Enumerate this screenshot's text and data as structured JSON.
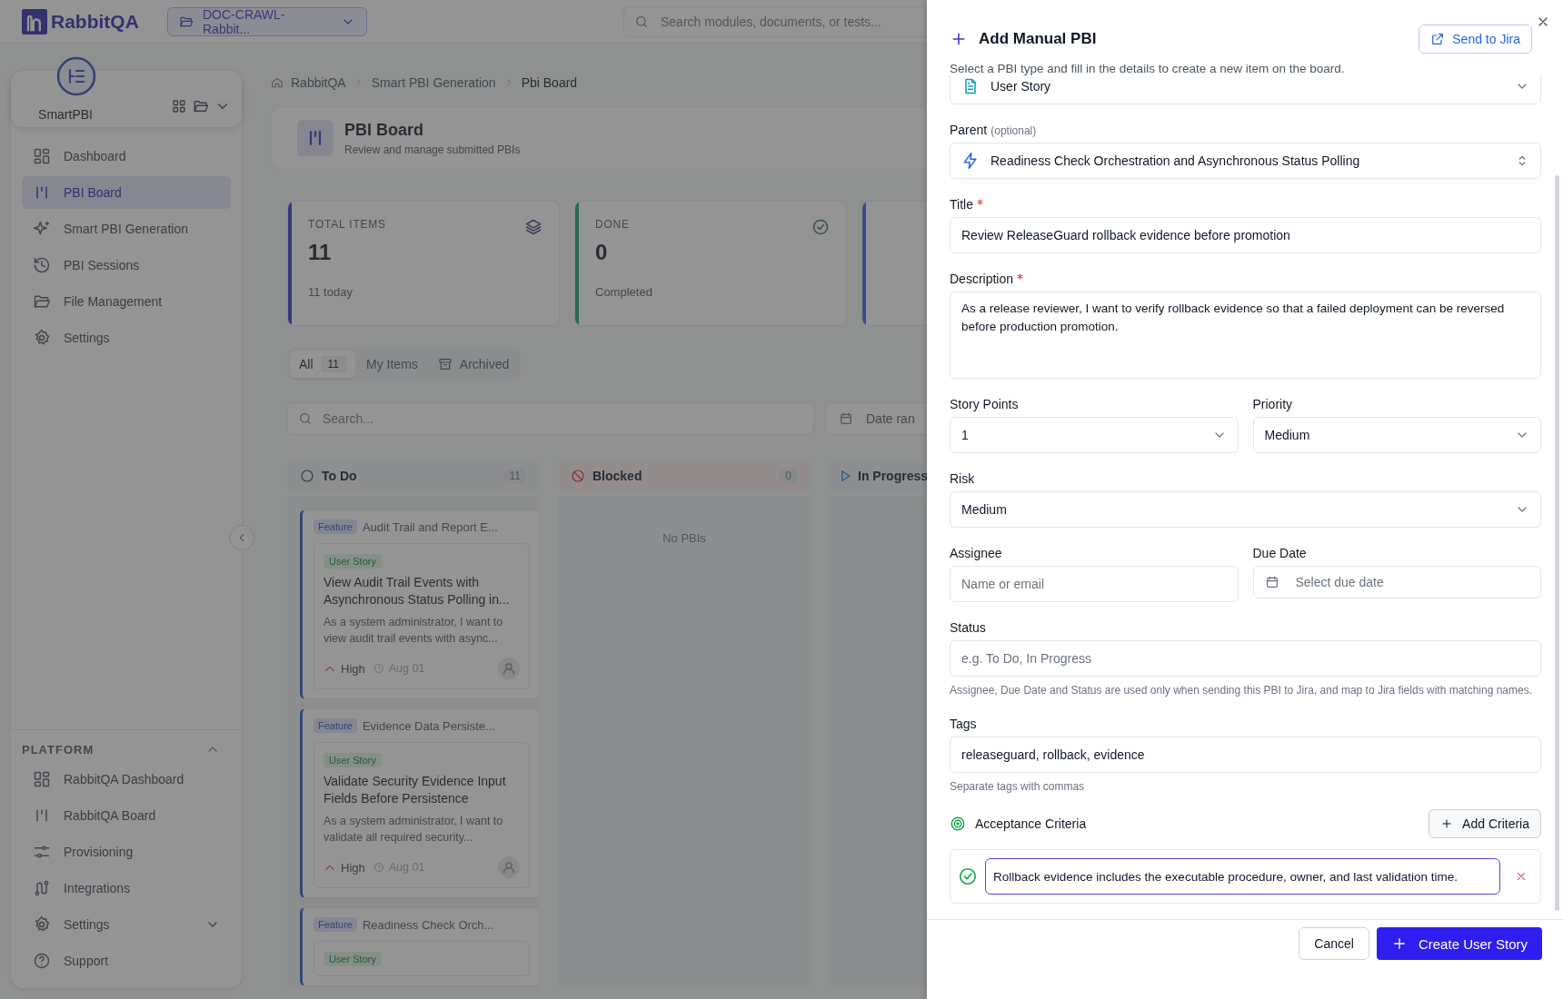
{
  "topbar": {
    "logo": "RabbitQA",
    "project": "DOC-CRAWL-Rabbit...",
    "search_placeholder": "Search modules, documents, or tests..."
  },
  "sidebar": {
    "app_name": "SmartPBI",
    "items": [
      {
        "label": "Dashboard",
        "selected": false
      },
      {
        "label": "PBI Board",
        "selected": true
      },
      {
        "label": "Smart PBI Generation",
        "selected": false
      },
      {
        "label": "PBI Sessions",
        "selected": false
      },
      {
        "label": "File Management",
        "selected": false
      },
      {
        "label": "Settings",
        "selected": false
      }
    ],
    "platform": {
      "title": "PLATFORM",
      "expanded": true,
      "items": [
        {
          "label": "RabbitQA Dashboard",
          "submenu": false
        },
        {
          "label": "RabbitQA Board",
          "submenu": false
        },
        {
          "label": "Provisioning",
          "submenu": false
        },
        {
          "label": "Integrations",
          "submenu": false
        },
        {
          "label": "Settings",
          "submenu": true
        },
        {
          "label": "Support",
          "submenu": false
        }
      ]
    }
  },
  "breadcrumb": [
    "RabbitQA",
    "Smart PBI Generation",
    "Pbi Board"
  ],
  "page": {
    "title": "PBI Board",
    "subtitle": "Review and manage submitted PBIs"
  },
  "stats": [
    {
      "label": "TOTAL ITEMS",
      "value": "11",
      "note": "11 today",
      "color": "#3b377f"
    },
    {
      "label": "DONE",
      "value": "0",
      "note": "Completed",
      "color": "#2b6a51"
    },
    {
      "color": "#3b4f86"
    }
  ],
  "filters": [
    {
      "label": "All",
      "count": "11",
      "selected": true
    },
    {
      "label": "My Items",
      "selected": false
    },
    {
      "label": "Archived",
      "selected": false
    }
  ],
  "board_search_placeholder": "Search...",
  "date_range": "Date ran",
  "columns": [
    {
      "title": "To Do",
      "kind": "todo",
      "count": "11",
      "cards": [
        {
          "parent_type": "Feature",
          "parent": "Audit Trail and Report E...",
          "type": "User Story",
          "title": "View Audit Trail Events with Asynchronous Status Polling in...",
          "description": "As a system administrator, I want to view audit trail events with async...",
          "priority": "High",
          "due": "Aug 01"
        },
        {
          "parent_type": "Feature",
          "parent": "Evidence Data Persiste...",
          "type": "User Story",
          "title": "Validate Security Evidence Input Fields Before Persistence",
          "description": "As a system administrator, I want to validate all required security...",
          "priority": "High",
          "due": "Aug 01"
        },
        {
          "parent_type": "Feature",
          "parent": "Readiness Check Orch...",
          "type": "User Story"
        }
      ]
    },
    {
      "title": "Blocked",
      "kind": "blocked",
      "count": "0",
      "empty": "No PBIs"
    },
    {
      "title": "In Progress",
      "kind": "progress"
    }
  ],
  "panel": {
    "title": "Add Manual PBI",
    "send_button": "Send to Jira",
    "subtitle": "Select a PBI type and fill in the details to create a new item on the board.",
    "type_value": "User Story",
    "rows": [
      [
        {
          "kind": "updown",
          "label": "Parent",
          "hint": "(optional)",
          "required": false,
          "value": "Readiness Check Orchestration and Asynchronous Status Polling"
        }
      ],
      [
        {
          "kind": "text",
          "label": "Title",
          "required": true,
          "value": "Review ReleaseGuard rollback evidence before promotion"
        }
      ],
      [
        {
          "kind": "textarea",
          "label": "Description",
          "required": true,
          "value": "As a release reviewer, I want to verify rollback evidence so that a failed deployment can be reversed before production promotion."
        }
      ],
      [
        {
          "kind": "select",
          "label": "Story Points",
          "required": false,
          "value": "1"
        },
        {
          "kind": "select",
          "label": "Priority",
          "required": false,
          "value": "Medium"
        }
      ],
      [
        {
          "kind": "select",
          "label": "Risk",
          "required": false,
          "value": "Medium"
        }
      ],
      [
        {
          "kind": "text",
          "label": "Assignee",
          "required": false,
          "placeholder": "Name or email"
        },
        {
          "kind": "date",
          "label": "Due Date",
          "required": false,
          "placeholder": "Select due date"
        }
      ],
      [
        {
          "kind": "text",
          "label": "Status",
          "required": false,
          "placeholder": "e.g. To Do, In Progress",
          "help": "Assignee, Due Date and Status are used only when sending this PBI to Jira, and map to Jira fields with matching names."
        }
      ],
      [
        {
          "kind": "text",
          "label": "Tags",
          "required": false,
          "value": "releaseguard, rollback, evidence",
          "help": "Separate tags with commas"
        }
      ]
    ],
    "criteria_title": "Acceptance Criteria",
    "add_criteria": "Add Criteria",
    "criteria": [
      {
        "text": "Rollback evidence includes the executable procedure, owner, and last validation time.",
        "focused": true
      }
    ],
    "cancel": "Cancel",
    "create": "Create User Story"
  }
}
